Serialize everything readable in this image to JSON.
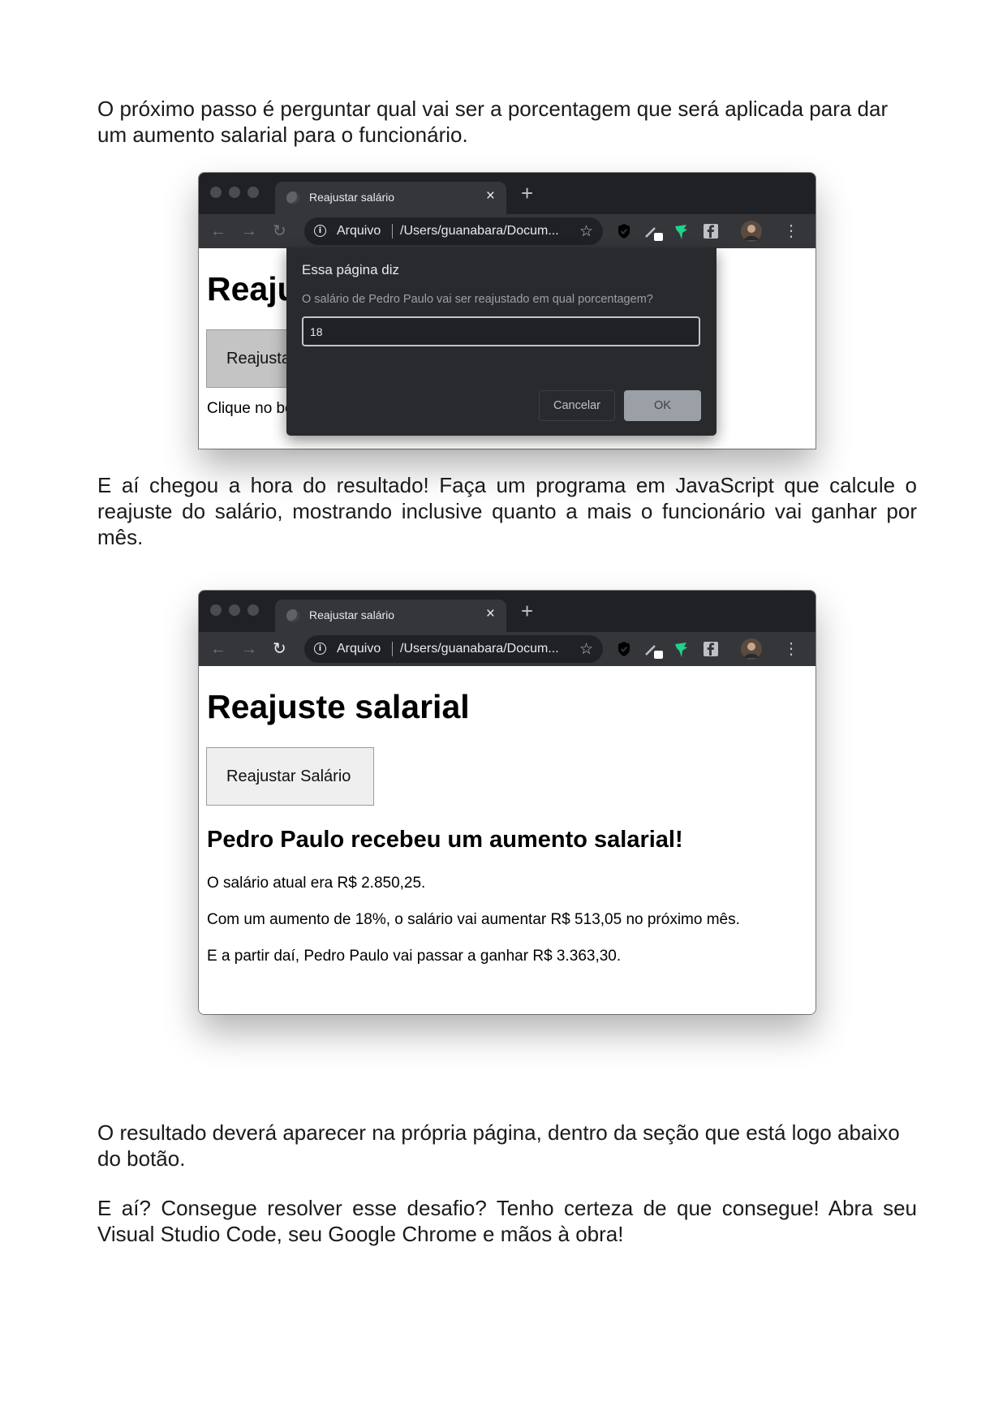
{
  "paragraphs": {
    "p1": "O próximo passo é perguntar qual vai ser a porcentagem que será aplicada para dar um aumento salarial para o funcionário.",
    "p2": "E aí chegou a hora do resultado! Faça um programa em JavaScript que calcule o reajuste do salário, mostrando inclusive quanto a mais o funcionário vai ganhar por mês.",
    "p3": "O resultado deverá aparecer na própria página, dentro da seção que está logo abaixo do botão.",
    "p4": "E aí? Consegue resolver esse desafio? Tenho certeza de que consegue! Abra seu Visual Studio Code, seu Google Chrome e mãos à obra!"
  },
  "browser": {
    "tab_title": "Reajustar salário",
    "tab_close": "×",
    "new_tab": "+",
    "omnibox_label": "Arquivo",
    "omnibox_url": "/Users/guanabara/Docum...",
    "icons": [
      "back-arrow-icon",
      "forward-arrow-icon",
      "reload-icon",
      "info-icon",
      "star-icon",
      "shield-extension-icon",
      "pen-extension-icon",
      "bird-extension-icon",
      "facebook-extension-icon",
      "profile-avatar",
      "kebab-menu-icon"
    ]
  },
  "screen1": {
    "heading": "Reajuste salarial",
    "button": "Reajustar Salário",
    "hint": "Clique no botão para reajustar o salário.",
    "dialog": {
      "title": "Essa página diz",
      "message": "O salário de Pedro Paulo vai ser reajustado em qual porcentagem?",
      "input_value": "18",
      "cancel": "Cancelar",
      "ok": "OK"
    }
  },
  "screen2": {
    "heading": "Reajuste salarial",
    "button": "Reajustar Salário",
    "result_title": "Pedro Paulo recebeu um aumento salarial!",
    "line1": "O salário atual era R$ 2.850,25.",
    "line2": "Com um aumento de 18%, o salário vai aumentar R$ 513,05 no próximo mês.",
    "line3": "E a partir daí, Pedro Paulo vai passar a ganhar R$ 3.363,30."
  },
  "colors": {
    "tab_strip": "#202124",
    "toolbar": "#35363a",
    "dialog_bg": "#292a2d",
    "ok_button": "#9aa0a6",
    "extension_green": "#1fd38b"
  }
}
